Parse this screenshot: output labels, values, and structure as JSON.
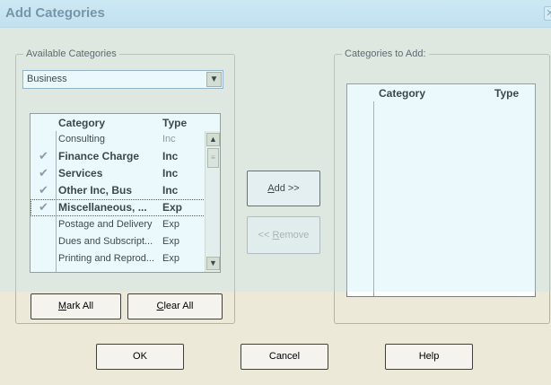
{
  "window": {
    "title": "Add Categories",
    "close_glyph": "✕"
  },
  "available": {
    "group_label": "Available Categories",
    "dropdown_value": "Business",
    "columns": [
      "Category",
      "Type"
    ],
    "rows": [
      {
        "category": "Consulting",
        "type": "Inc",
        "checked": false
      },
      {
        "category": "Finance Charge",
        "type": "Inc",
        "checked": true
      },
      {
        "category": "Services",
        "type": "Inc",
        "checked": true
      },
      {
        "category": "Other Inc, Bus",
        "type": "Inc",
        "checked": true
      },
      {
        "category": "Miscellaneous, ...",
        "type": "Exp",
        "checked": true
      },
      {
        "category": "Postage and Delivery",
        "type": "Exp",
        "checked": false
      },
      {
        "category": "Dues and Subscript...",
        "type": "Exp",
        "checked": false
      },
      {
        "category": "Printing and Reprod...",
        "type": "Exp",
        "checked": false
      }
    ],
    "mark_all": {
      "mnemonic": "M",
      "rest": "ark All"
    },
    "clear_all": {
      "mnemonic": "C",
      "rest": "lear All"
    }
  },
  "to_add": {
    "group_label": "Categories to Add:",
    "columns": [
      "Category",
      "Type"
    ],
    "rows": []
  },
  "middle": {
    "add": {
      "mnemonic": "A",
      "rest": "dd >>"
    },
    "remove": {
      "prefix": "<< ",
      "mnemonic": "R",
      "rest": "emove"
    }
  },
  "footer": {
    "ok": "OK",
    "cancel": "Cancel",
    "help": "Help"
  },
  "icons": {
    "check": "check-icon",
    "dropdown": "dropdown-arrow-icon"
  }
}
